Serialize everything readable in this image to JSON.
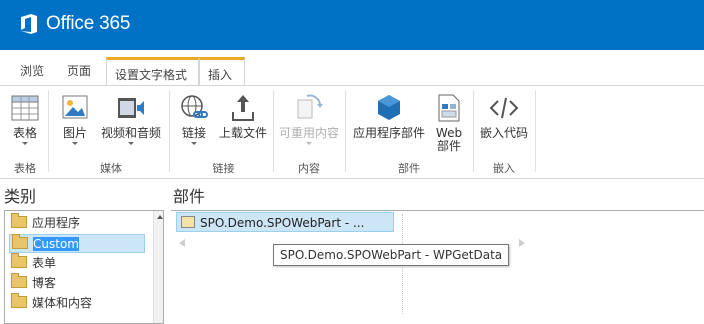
{
  "header": {
    "brand": "Office 365",
    "bar_color": "#0072c6"
  },
  "tabs": [
    {
      "label": "浏览"
    },
    {
      "label": "页面"
    },
    {
      "label": "设置文字格式"
    },
    {
      "label": "插入"
    }
  ],
  "ribbon": {
    "buttons": {
      "table": "表格",
      "picture": "图片",
      "video_audio": "视频和音频",
      "link": "链接",
      "upload_file": "上载文件",
      "reusable_content": "可重用内容",
      "app_part": "应用程序部件",
      "web_part_line1": "Web",
      "web_part_line2": "部件",
      "embed_code": "嵌入代码"
    },
    "groups": {
      "table": "表格",
      "media": "媒体",
      "links": "链接",
      "content": "内容",
      "parts": "部件",
      "embed": "嵌入"
    }
  },
  "categories": {
    "header": "类别",
    "items": [
      "应用程序",
      "Custom",
      "表单",
      "博客",
      "媒体和内容"
    ],
    "selected": "Custom"
  },
  "parts": {
    "header": "部件",
    "items": [
      "SPO.Demo.SPOWebPart - ..."
    ],
    "tooltip": "SPO.Demo.SPOWebPart - WPGetData"
  }
}
